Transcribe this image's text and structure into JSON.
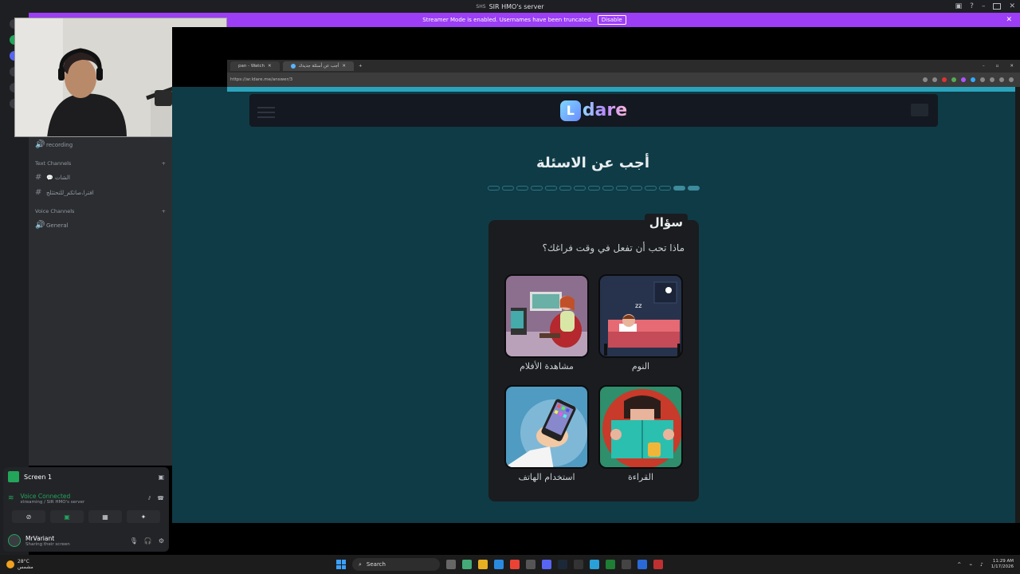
{
  "window": {
    "title": "SIR HMO's server"
  },
  "streamer_banner": {
    "text": "Streamer Mode is enabled. Usernames have been truncated.",
    "button": "Disable"
  },
  "channels": {
    "top_item": "recording",
    "text_category": "Text Channels",
    "text_items": [
      "💬 الشات",
      "افترا،صاتكم_للتحتثلج"
    ],
    "voice_category": "Voice Channels",
    "voice_items": [
      "General"
    ]
  },
  "voice_panel": {
    "screen_label": "Screen 1",
    "status": "Voice Connected",
    "status_sub": "streaming / SIR HMO's server",
    "username": "MrVariant",
    "user_sub": "Sharing their screen"
  },
  "browser": {
    "tab1": "pan - Watch",
    "tab2": "أجب عن أسئلة جديدك",
    "url": "https://ar.ldare.me/answer/3"
  },
  "page": {
    "brand": "dare",
    "brand_letter": "L",
    "title": "أجب عن الاسئلة",
    "progress_total": 15,
    "progress_done": 2,
    "card_tag": "سؤال",
    "question": "ماذا تحب أن تفعل في وقت فراغك؟",
    "options": [
      {
        "label": "مشاهدة الأفلام",
        "icon": "tv-watching-image"
      },
      {
        "label": "النوم",
        "icon": "sleeping-image"
      },
      {
        "label": "استخدام الهاتف",
        "icon": "phone-image"
      },
      {
        "label": "القراءة",
        "icon": "reading-image"
      }
    ]
  },
  "taskbar": {
    "temperature": "28°C",
    "weather": "مشمس",
    "search": "Search",
    "time": "11:29 AM",
    "date": "1/17/2026"
  },
  "colors": {
    "accent": "#9b3ef5",
    "page_bg": "#0f3b46",
    "green": "#23a55a"
  }
}
